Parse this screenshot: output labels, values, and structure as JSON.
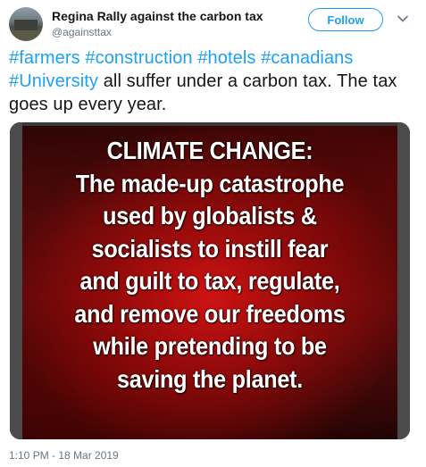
{
  "author": {
    "display_name": "Regina Rally against the carbon tax",
    "handle": "@againsttax"
  },
  "follow_button": {
    "label": "Follow"
  },
  "tweet": {
    "hashtags": [
      "#farmers",
      "#construction",
      "#hotels",
      "#canadians",
      "#University"
    ],
    "text_after_hashtags": "all suffer under a carbon tax. The tax goes up every year.",
    "timestamp": "1:10 PM - 18 Mar 2019"
  },
  "media": {
    "lines": [
      "CLIMATE CHANGE:",
      "The made-up catastrophe",
      "used by globalists &",
      "socialists to instill fear",
      "and guilt to tax, regulate,",
      "and remove our freedoms",
      "while pretending to be",
      "saving the planet."
    ]
  },
  "icons": {
    "avatar": "profile-photo",
    "chevron": "chevron-down-icon"
  },
  "colors": {
    "link": "#1da1f2",
    "text": "#14171a",
    "muted": "#657786",
    "poster_red": "#b01010"
  }
}
